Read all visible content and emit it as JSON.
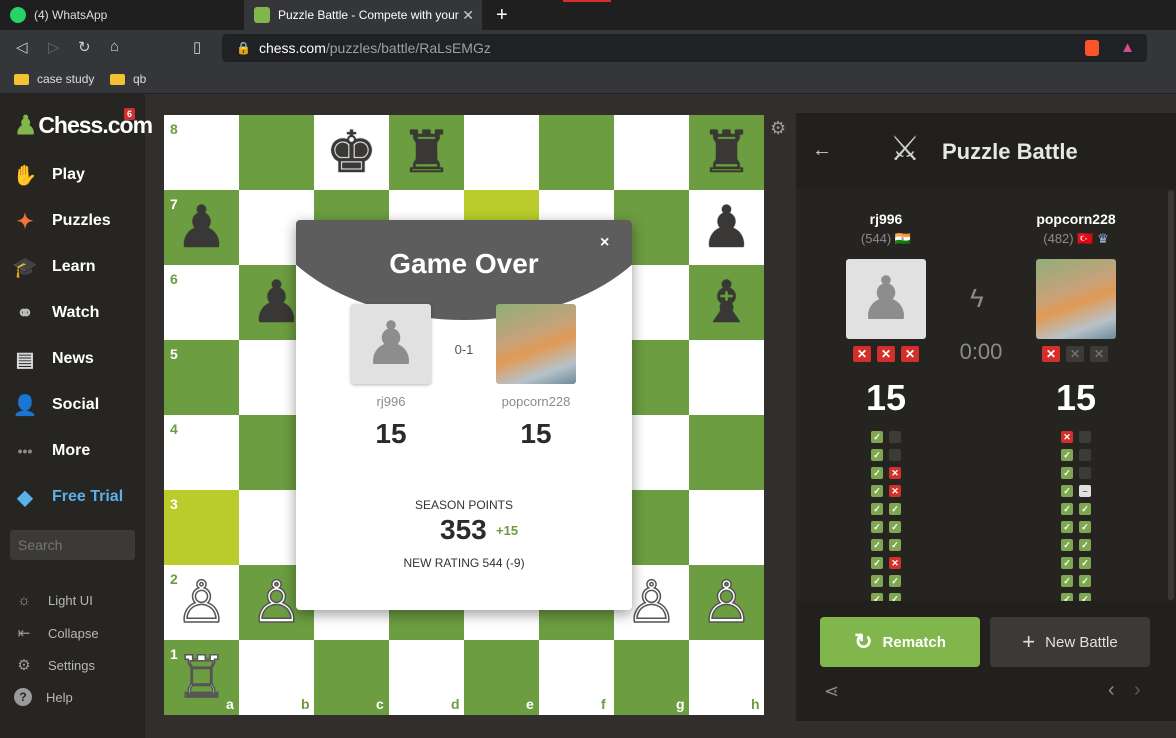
{
  "browser": {
    "tabs": [
      {
        "label": "(4) WhatsApp",
        "icon": "whatsapp-icon"
      },
      {
        "label": "Puzzle Battle - Compete with your",
        "icon": "chess-pawn-icon"
      }
    ],
    "url_host": "chess.com",
    "url_path": "/puzzles/battle/RaLsEMGz",
    "bookmarks": [
      "case study",
      "qb"
    ]
  },
  "sidebar": {
    "logo": "Chess.com",
    "logo_badge": "6",
    "items": [
      {
        "label": "Play",
        "icon": "play-hand-icon"
      },
      {
        "label": "Puzzles",
        "icon": "puzzle-icon"
      },
      {
        "label": "Learn",
        "icon": "graduation-cap-icon"
      },
      {
        "label": "Watch",
        "icon": "binoculars-icon"
      },
      {
        "label": "News",
        "icon": "newspaper-icon"
      },
      {
        "label": "Social",
        "icon": "people-icon"
      },
      {
        "label": "More",
        "icon": "more-dots-icon"
      },
      {
        "label": "Free Trial",
        "icon": "diamond-icon"
      }
    ],
    "search_placeholder": "Search",
    "bottom": [
      {
        "label": "Light UI",
        "icon": "sun-icon"
      },
      {
        "label": "Collapse",
        "icon": "collapse-icon"
      },
      {
        "label": "Settings",
        "icon": "gear-icon"
      },
      {
        "label": "Help",
        "icon": "help-icon"
      }
    ],
    "colors": {
      "free_trial": "#5bb0e8",
      "accent": "#81b64c"
    }
  },
  "board": {
    "ranks": [
      "8",
      "7",
      "6",
      "5",
      "4",
      "3",
      "2",
      "1"
    ],
    "files": [
      "a",
      "b",
      "c",
      "d",
      "e",
      "f",
      "g",
      "h"
    ],
    "highlight_squares": [
      "e7",
      "a3"
    ],
    "pieces": [
      {
        "sq": "c8",
        "p": "♚",
        "c": "b"
      },
      {
        "sq": "d8",
        "p": "♜",
        "c": "b"
      },
      {
        "sq": "h8",
        "p": "♜",
        "c": "b"
      },
      {
        "sq": "a7",
        "p": "♟",
        "c": "b"
      },
      {
        "sq": "h7",
        "p": "♟",
        "c": "b"
      },
      {
        "sq": "b6",
        "p": "♟",
        "c": "b"
      },
      {
        "sq": "h6",
        "p": "♝",
        "c": "b"
      },
      {
        "sq": "a2",
        "p": "♙",
        "c": "w"
      },
      {
        "sq": "b2",
        "p": "♙",
        "c": "w"
      },
      {
        "sq": "g2",
        "p": "♙",
        "c": "w"
      },
      {
        "sq": "h2",
        "p": "♙",
        "c": "w"
      },
      {
        "sq": "a1",
        "p": "♖",
        "c": "w"
      }
    ]
  },
  "modal": {
    "title": "Game Over",
    "close": "×",
    "result": "0-1",
    "player1": {
      "name": "rj996",
      "points": "15"
    },
    "player2": {
      "name": "popcorn228",
      "points": "15"
    },
    "season_label": "SEASON POINTS",
    "season_value": "353",
    "season_delta": "+15",
    "new_rating": "NEW RATING 544 (-9)"
  },
  "panel": {
    "title": "Puzzle Battle",
    "player1": {
      "name": "rj996",
      "rating": "(544)",
      "flag": "🇮🇳",
      "score": "15",
      "strikes": [
        true,
        true,
        true
      ]
    },
    "player2": {
      "name": "popcorn228",
      "rating": "(482)",
      "flag": "🇹🇷",
      "score": "15",
      "strikes": [
        true,
        false,
        false
      ]
    },
    "timer": "0:00",
    "p1_results": [
      [
        "ok",
        "empty"
      ],
      [
        "ok",
        "empty"
      ],
      [
        "ok",
        "bad"
      ],
      [
        "ok",
        "bad"
      ],
      [
        "ok",
        "ok"
      ],
      [
        "ok",
        "ok"
      ],
      [
        "ok",
        "ok"
      ],
      [
        "ok",
        "bad"
      ],
      [
        "ok",
        "ok"
      ],
      [
        "ok",
        "ok"
      ],
      [
        "ok",
        "ok"
      ]
    ],
    "p2_results": [
      [
        "bad",
        "empty"
      ],
      [
        "ok",
        "empty"
      ],
      [
        "ok",
        "empty"
      ],
      [
        "ok",
        "skip"
      ],
      [
        "ok",
        "ok"
      ],
      [
        "ok",
        "ok"
      ],
      [
        "ok",
        "ok"
      ],
      [
        "ok",
        "ok"
      ],
      [
        "ok",
        "ok"
      ],
      [
        "ok",
        "ok"
      ],
      [
        "ok",
        "ok"
      ]
    ],
    "rematch": "Rematch",
    "new_battle": "New Battle"
  }
}
